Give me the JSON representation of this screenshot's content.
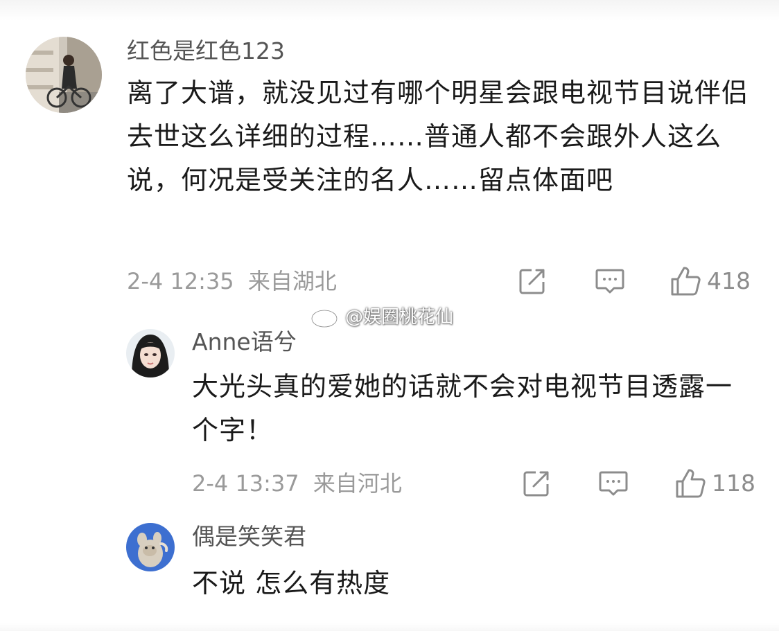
{
  "comments": [
    {
      "username": "红色是红色123",
      "text": "离了大谱，就没见过有哪个明星会跟电视节目说伴侣去世这么详细的过程……普通人都不会跟外人这么说，何况是受关注的名人……留点体面吧",
      "time": "2-4 12:35",
      "location": "来自湖北",
      "likes": "418"
    },
    {
      "username": "Anne语兮",
      "text": "大光头真的爱她的话就不会对电视节目透露一个字！",
      "time": "2-4 13:37",
      "location": "来自河北",
      "likes": "118"
    },
    {
      "username": "偶是笑笑君",
      "text": "不说 怎么有热度"
    }
  ],
  "watermark": "@娱圈桃花仙",
  "icons": {
    "share": "share-icon",
    "reply": "comment-icon",
    "like": "thumbs-up-icon",
    "watermark": "weibo-logo-icon"
  },
  "colors": {
    "username": "#555555",
    "text": "#1a1a1a",
    "meta": "#9a9a9a",
    "icon": "#8c8c8c"
  }
}
